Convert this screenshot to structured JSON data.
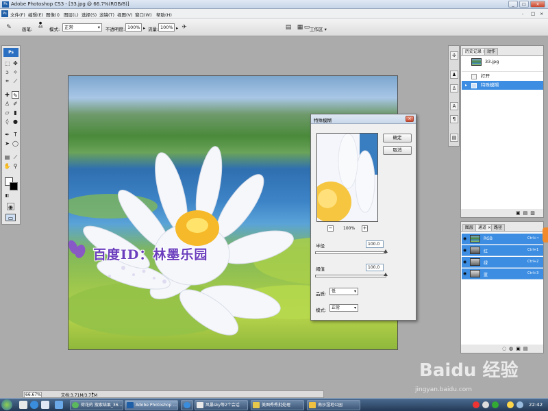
{
  "window": {
    "title": "Adobe Photoshop CS3 - [33.jpg @ 66.7%(RGB/8)]",
    "controls": [
      "_",
      "□",
      "×"
    ]
  },
  "menubar": {
    "items": [
      "文件(F)",
      "编辑(E)",
      "图像(I)",
      "图层(L)",
      "选择(S)",
      "滤镜(T)",
      "视图(V)",
      "窗口(W)",
      "帮助(H)"
    ],
    "doc_controls": [
      "-",
      "□",
      "×"
    ]
  },
  "options": {
    "brush_label": "画笔:",
    "brush_size": "44",
    "mode_label": "模式:",
    "mode_value": "正常",
    "opacity_label": "不透明度:",
    "opacity_value": "100%",
    "flow_label": "流量:",
    "flow_value": "100%",
    "workspace_label": "工作区 ▾"
  },
  "toolbox": {
    "logo": "Ps"
  },
  "canvas": {
    "watermark": "百度ID：林墨乐园"
  },
  "dialog": {
    "title": "特殊模糊",
    "ok": "确定",
    "cancel": "取消",
    "zoom_out": "−",
    "zoom_in": "+",
    "zoom_value": "100%",
    "radius_label": "半径",
    "radius_value": "100.0",
    "threshold_label": "阈值",
    "threshold_value": "100.0",
    "quality_label": "品质:",
    "quality_value": "低",
    "mode_label": "模式:",
    "mode_value": "正常"
  },
  "history_panel": {
    "tabs": [
      "历史记录 ×",
      "动作"
    ],
    "snapshot": "33.jpg",
    "items": [
      "打开",
      "特殊模糊"
    ]
  },
  "layers_panel": {
    "tabs": [
      "图层",
      "通道 ×",
      "路径"
    ],
    "channels": [
      {
        "name": "RGB",
        "shortcut": "Ctrl+~"
      },
      {
        "name": "红",
        "shortcut": "Ctrl+1"
      },
      {
        "name": "绿",
        "shortcut": "Ctrl+2"
      },
      {
        "name": "蓝",
        "shortcut": "Ctrl+3"
      }
    ]
  },
  "status": {
    "zoom": "66.67%",
    "doc": "文档:3.71M/3.71M"
  },
  "taskbar": {
    "tasks": [
      "荷花的 搜索结果_36...",
      "Adobe Photoshop ...",
      "风暴sky等2个会话",
      "美图秀秀批处理",
      "南沙湿地公园"
    ],
    "clock": "22:42"
  },
  "baidu": {
    "logo": "Baidu 经验",
    "url": "jingyan.baidu.com"
  },
  "colors": {
    "accent": "#3d8ee3",
    "watermark": "#6a3dbd",
    "taskbar": "#2c4566"
  }
}
